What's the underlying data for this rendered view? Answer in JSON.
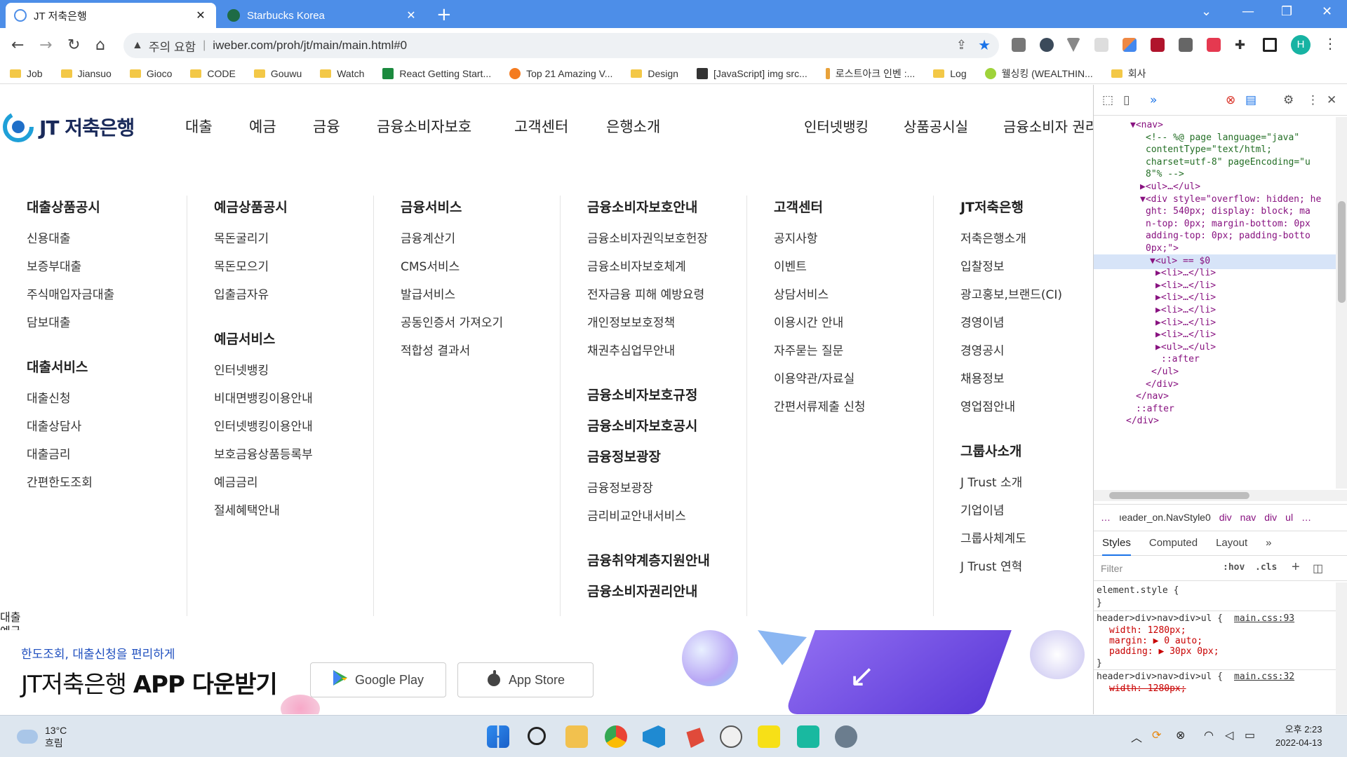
{
  "browser": {
    "tabs": [
      {
        "title": "JT 저축은행",
        "active": true,
        "icon": "jt-favicon"
      },
      {
        "title": "Starbucks Korea",
        "active": false,
        "icon": "starbucks-favicon"
      }
    ],
    "close_glyph": "✕",
    "newtab_glyph": "+",
    "address": {
      "security_label": "주의 요함",
      "url": "iweber.com/proh/jt/main/main.html#0"
    },
    "profile_initial": "H",
    "bookmarks": [
      "Job",
      "Jiansuo",
      "Gioco",
      "CODE",
      "Gouwu",
      "Watch",
      "React Getting Start...",
      "Top 21 Amazing V...",
      "Design",
      "[JavaScript] img src...",
      "로스트아크 인벤 :...",
      "Log",
      "웰싱킹 (WEALTHIN...",
      "회사"
    ]
  },
  "site": {
    "logo_text": "JT 저축은행",
    "gnb": [
      "대출",
      "예금",
      "금융",
      "금융소비자보호",
      "고객센터",
      "은행소개"
    ],
    "util": [
      "인터넷뱅킹",
      "상품공시실",
      "금융소비자 권리"
    ],
    "mega": [
      {
        "sections": [
          {
            "head": "대출상품공시",
            "items": [
              "신용대출",
              "보증부대출",
              "주식매입자금대출",
              "담보대출"
            ]
          },
          {
            "head": "대출서비스",
            "items": [
              "대출신청",
              "대출상담사",
              "대출금리",
              "간편한도조회"
            ]
          }
        ]
      },
      {
        "sections": [
          {
            "head": "예금상품공시",
            "items": [
              "목돈굴리기",
              "목돈모으기",
              "입출금자유"
            ]
          },
          {
            "head": "예금서비스",
            "items": [
              "인터넷뱅킹",
              "비대면뱅킹이용안내",
              "인터넷뱅킹이용안내",
              "보호금융상품등록부",
              "예금금리",
              "절세혜택안내"
            ]
          }
        ]
      },
      {
        "sections": [
          {
            "head": "금융서비스",
            "items": [
              "금융계산기",
              "CMS서비스",
              "발급서비스",
              "공동인증서 가져오기",
              "적합성 결과서"
            ]
          }
        ]
      },
      {
        "sections": [
          {
            "head": "금융소비자보호안내",
            "items": [
              "금융소비자권익보호헌장",
              "금융소비자보호체계",
              "전자금융 피해 예방요령",
              "개인정보보호정책",
              "채권추심업무안내"
            ]
          },
          {
            "head": "금융소비자보호규정",
            "items": []
          },
          {
            "head": "금융소비자보호공시",
            "items": []
          },
          {
            "head": "금융정보광장",
            "items": [
              "금융정보광장",
              "금리비교안내서비스"
            ]
          },
          {
            "head": "금융취약계층지원안내",
            "items": []
          },
          {
            "head": "금융소비자권리안내",
            "items": []
          }
        ]
      },
      {
        "sections": [
          {
            "head": "고객센터",
            "items": [
              "공지사항",
              "이벤트",
              "상담서비스",
              "이용시간 안내",
              "자주묻는 질문",
              "이용약관/자료실",
              "간편서류제출 신청"
            ]
          }
        ]
      },
      {
        "sections": [
          {
            "head": "JT저축은행",
            "items": [
              "저축은행소개",
              "입찰정보",
              "광고홍보,브랜드(CI)",
              "경영이념",
              "경영공시",
              "채용정보",
              "영업점안내"
            ]
          },
          {
            "head": "그룹사소개",
            "items": [
              "J Trust 소개",
              "기업이념",
              "그룹사체계도",
              "J Trust 연혁"
            ]
          }
        ]
      }
    ],
    "side_labels": [
      "대출",
      "예금"
    ],
    "banner": {
      "subtitle": "한도조회, 대출신청을 편리하게",
      "title_plain": "JT저축은행 ",
      "title_bold": "APP 다운받기",
      "google_play": "Google Play",
      "app_store": "App Store"
    }
  },
  "devtools": {
    "dom_lines": [
      {
        "t": "▼<nav>"
      },
      {
        "t": "<!-- %@ page language=\"java\"",
        "c": true
      },
      {
        "t": "contentType=\"text/html;",
        "c": true
      },
      {
        "t": "charset=utf-8\" pageEncoding=\"u",
        "c": true
      },
      {
        "t": "8\"% -->",
        "c": true
      },
      {
        "t": "▶<ul>…</ul>"
      },
      {
        "t": "▼<div style=\"overflow: hidden; he"
      },
      {
        "t": "ght: 540px; display: block; ma"
      },
      {
        "t": "n-top: 0px; margin-bottom: 0px"
      },
      {
        "t": "adding-top: 0px; padding-botto"
      },
      {
        "t": "0px;\">"
      },
      {
        "t": "▼<ul> == $0"
      },
      {
        "t": "▶<li>…</li>"
      },
      {
        "t": "▶<li>…</li>"
      },
      {
        "t": "▶<li>…</li>"
      },
      {
        "t": "▶<li>…</li>"
      },
      {
        "t": "▶<li>…</li>"
      },
      {
        "t": "▶<li>…</li>"
      },
      {
        "t": "▶<ul>…</ul>"
      },
      {
        "t": "::after"
      },
      {
        "t": "</ul>"
      },
      {
        "t": "</div>"
      },
      {
        "t": "</nav>"
      },
      {
        "t": "::after"
      },
      {
        "t": "</div>"
      }
    ],
    "breadcrumbs": [
      "…",
      "ıeader_on.NavStyle0",
      "div",
      "nav",
      "div",
      "ul",
      "…"
    ],
    "style_tabs": [
      "Styles",
      "Computed",
      "Layout",
      "»"
    ],
    "filter_placeholder": "Filter",
    "hov": ":hov",
    "cls": ".cls",
    "rules": {
      "element_style": "element.style {",
      "close": "}",
      "rule1_selector": "header>div>nav>div>ul {",
      "rule1_source": "main.css:93",
      "rule1_props": [
        "width: 1280px;",
        "margin: ▶ 0 auto;",
        "padding: ▶ 30px 0px;"
      ],
      "rule2_selector": "header>div>nav>div>ul {",
      "rule2_source": "main.css:32",
      "rule2_props": [
        "width: 1280px;"
      ]
    }
  },
  "taskbar": {
    "weather_temp": "13°C",
    "weather_desc": "흐림",
    "time": "오후 2:23",
    "date": "2022-04-13"
  }
}
